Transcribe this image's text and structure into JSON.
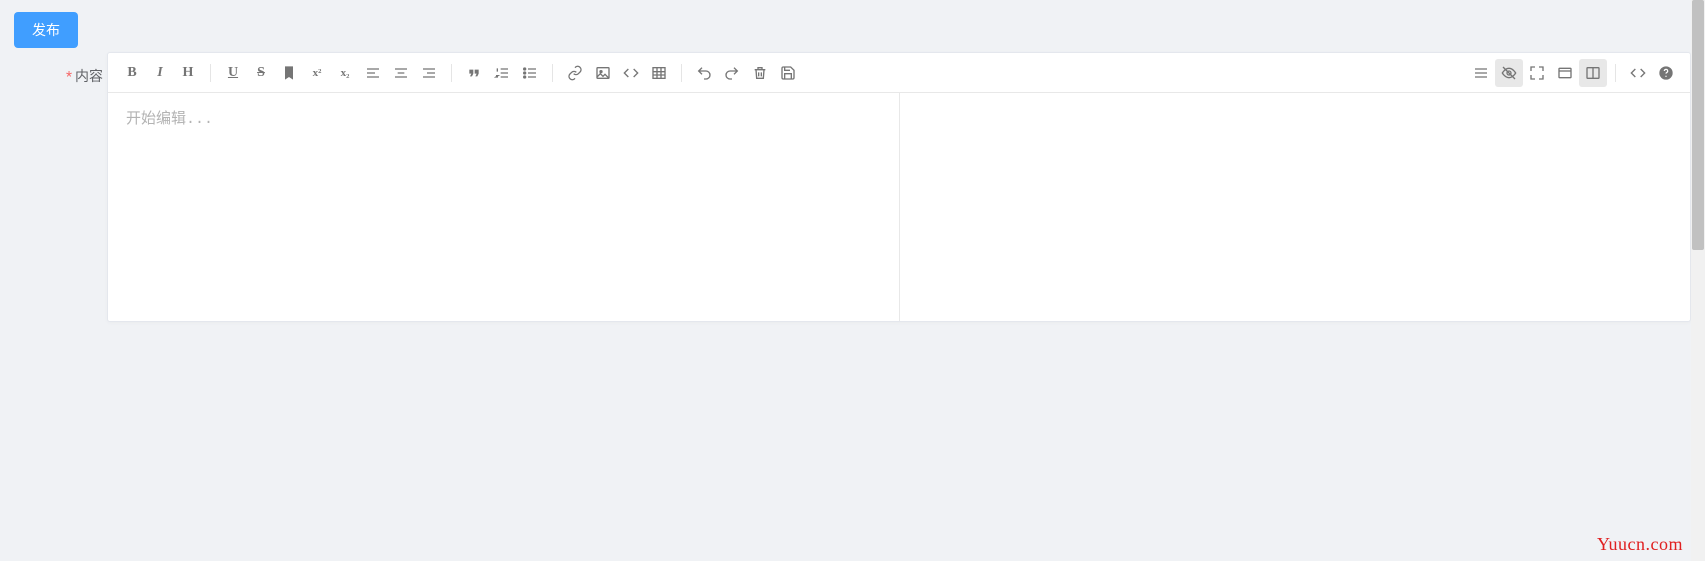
{
  "button": {
    "publish_label": "发布"
  },
  "form": {
    "content_label": "内容"
  },
  "editor": {
    "placeholder": "开始编辑..."
  },
  "toolbar": {
    "bold": "B",
    "italic": "I",
    "heading": "H",
    "underline": "U",
    "strike": "S",
    "sup": "x²",
    "sub": "x₂"
  },
  "watermark": "Yuucn.com"
}
